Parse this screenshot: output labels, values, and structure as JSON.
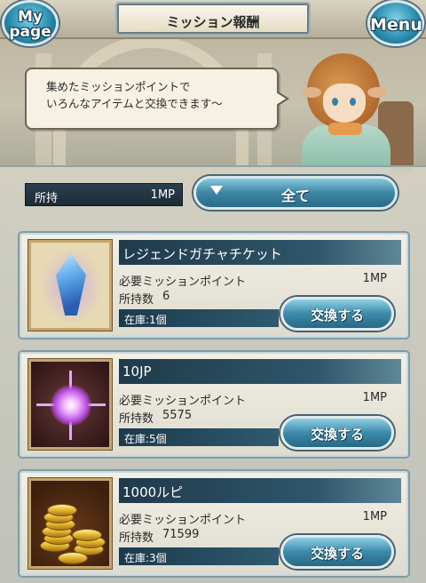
{
  "header": {
    "title": "ミッション報酬",
    "mypage_label_line1": "My",
    "mypage_label_line2": "page",
    "menu_label": "Menu"
  },
  "bubble": {
    "line1": "集めたミッションポイントで",
    "line2": "いろんなアイテムと交換できます～"
  },
  "points": {
    "label": "所持",
    "value": "1MP"
  },
  "filter": {
    "label": "全て"
  },
  "items": [
    {
      "name": "レジェンドガチャチケット",
      "required_label": "必要ミッションポイント",
      "required_value": "1MP",
      "owned_label": "所持数",
      "owned_value": "6",
      "stock": "在庫:1個",
      "button": "交換する",
      "icon": "legend-ticket-crystal-icon"
    },
    {
      "name": "10JP",
      "required_label": "必要ミッションポイント",
      "required_value": "1MP",
      "owned_label": "所持数",
      "owned_value": "5575",
      "stock": "在庫:5個",
      "button": "交換する",
      "icon": "jp-orb-icon"
    },
    {
      "name": "1000ルピ",
      "required_label": "必要ミッションポイント",
      "required_value": "1MP",
      "owned_label": "所持数",
      "owned_value": "71599",
      "stock": "在庫:3個",
      "button": "交換する",
      "icon": "rupie-coins-icon"
    }
  ],
  "colors": {
    "accent_blue": "#3c8aaa",
    "name_bar": "#203a4a",
    "card_bg": "#f2f0e6"
  }
}
